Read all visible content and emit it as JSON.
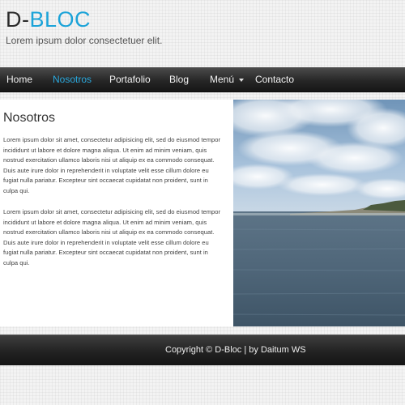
{
  "header": {
    "logo_prefix": "D-",
    "logo_accent": "BLOC",
    "tagline": "Lorem ipsum dolor consectetuer elit."
  },
  "nav": {
    "items": [
      {
        "label": "Home",
        "active": false
      },
      {
        "label": "Nosotros",
        "active": true
      },
      {
        "label": "Portafolio",
        "active": false
      },
      {
        "label": "Blog",
        "active": false
      },
      {
        "label": "Menú",
        "active": false,
        "has_dropdown": true,
        "icon": "caret-down-icon"
      },
      {
        "label": "Contacto",
        "active": false
      }
    ]
  },
  "main": {
    "title": "Nosotros",
    "paragraphs": [
      "Lorem ipsum dolor sit amet, consectetur adipisicing elit, sed do eiusmod tempor incididunt ut labore et dolore magna aliqua. Ut enim ad minim veniam, quis nostrud exercitation ullamco laboris nisi ut aliquip ex ea commodo consequat. Duis aute irure dolor in reprehenderit in voluptate velit esse cillum dolore eu fugiat nulla pariatur. Excepteur sint occaecat cupidatat non proident, sunt in culpa qui.",
      "Lorem ipsum dolor sit amet, consectetur adipisicing elit, sed do eiusmod tempor incididunt ut labore et dolore magna aliqua. Ut enim ad minim veniam, quis nostrud exercitation ullamco laboris nisi ut aliquip ex ea commodo consequat. Duis aute irure dolor in reprehenderit in voluptate velit esse cillum dolore eu fugiat nulla pariatur. Excepteur sint occaecat cupidatat non proident, sunt in culpa qui."
    ]
  },
  "footer": {
    "text": "Copyright © D-Bloc | by Daitum WS"
  },
  "colors": {
    "accent": "#1ba3d8",
    "nav_bg": "#262626",
    "footer_bg": "#222222",
    "page_bg": "#f3f3f3"
  }
}
